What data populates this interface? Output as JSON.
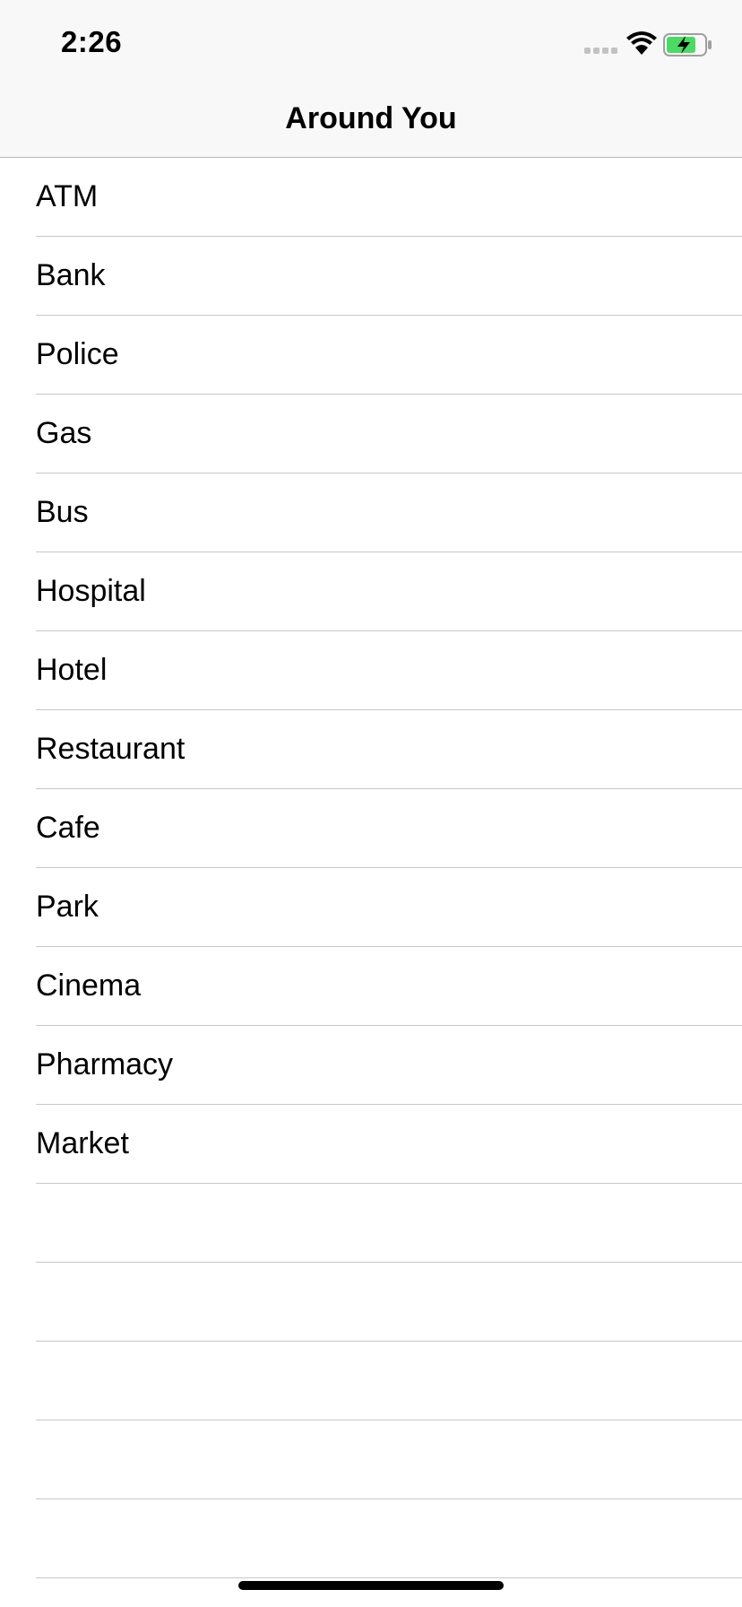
{
  "status_bar": {
    "time": "2:26",
    "icons": [
      "cellular-signal-icon",
      "wifi-icon",
      "battery-charging-icon"
    ]
  },
  "nav": {
    "title": "Around You"
  },
  "places": [
    {
      "label": "ATM"
    },
    {
      "label": "Bank"
    },
    {
      "label": "Police"
    },
    {
      "label": "Gas"
    },
    {
      "label": "Bus"
    },
    {
      "label": "Hospital"
    },
    {
      "label": "Hotel"
    },
    {
      "label": "Restaurant"
    },
    {
      "label": "Cafe"
    },
    {
      "label": "Park"
    },
    {
      "label": "Cinema"
    },
    {
      "label": "Pharmacy"
    },
    {
      "label": "Market"
    }
  ],
  "empty_rows": 5,
  "colors": {
    "bar_background": "#f8f8f8",
    "separator": "#c8c7cc",
    "battery_fill": "#4cd964"
  }
}
